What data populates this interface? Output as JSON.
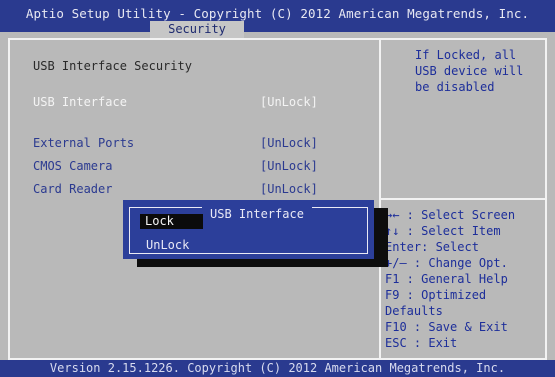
{
  "header": {
    "title": "Aptio Setup Utility - Copyright (C) 2012 American Megatrends, Inc.",
    "active_tab": "Security"
  },
  "main": {
    "section_title": "USB Interface Security",
    "usb_interface": {
      "label": "USB Interface",
      "value": "[UnLock]"
    },
    "external_ports": {
      "label": "External Ports",
      "value": "[UnLock]"
    },
    "cmos_camera": {
      "label": "CMOS Camera",
      "value": "[UnLock]"
    },
    "card_reader": {
      "label": "Card Reader",
      "value": "[UnLock]"
    }
  },
  "popup": {
    "title": "USB Interface",
    "options": [
      "Lock",
      "UnLock"
    ],
    "selected": "Lock"
  },
  "help": {
    "description_lines": [
      "If Locked, all",
      "USB device will",
      "be disabled"
    ],
    "keys": [
      "→←  : Select Screen",
      "↑↓  : Select Item",
      "Enter: Select",
      "+/—  : Change Opt.",
      "F1   : General Help",
      "F9   : Optimized",
      "Defaults",
      "F10  : Save & Exit",
      "ESC  : Exit"
    ]
  },
  "footer": {
    "version": "Version 2.15.1226. Copyright (C) 2012 American Megatrends, Inc."
  },
  "colors": {
    "bar": "#2a3a8f",
    "background": "#b9b9b9",
    "popup": "#2c3f9a",
    "selection": "#0b0b0b"
  }
}
